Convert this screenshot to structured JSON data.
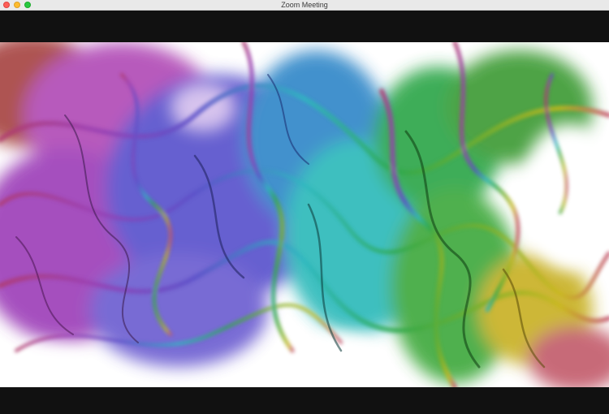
{
  "window": {
    "title": "Zoom Meeting"
  },
  "colors": {
    "letterbox": "#111111",
    "titlebar": "#e9e9e9",
    "traffic_close": "#fe5f57",
    "traffic_minimize": "#febc2e",
    "traffic_zoom": "#28c840"
  },
  "icons": {
    "close": "close-window-icon",
    "minimize": "minimize-window-icon",
    "zoom": "zoom-window-icon"
  },
  "video": {
    "content": "rainbow-smoke-image"
  }
}
